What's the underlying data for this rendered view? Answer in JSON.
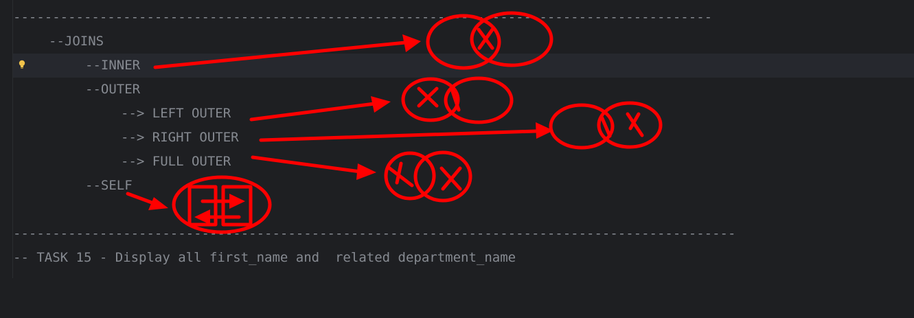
{
  "editor": {
    "lines": {
      "sep1": "-----------------------------------------------------------------------------------------",
      "joins": "--JOINS",
      "inner": "--INNER",
      "outer": "--OUTER",
      "left_outer": "--> LEFT OUTER",
      "right_outer": "--> RIGHT OUTER",
      "full_outer": "--> FULL OUTER",
      "self": "--SELF",
      "sep2": "--------------------------------------------------------------------------------------------",
      "task": "-- TASK 15 - Display all first_name and  related department_name"
    }
  },
  "colors": {
    "background": "#1e1f22",
    "current_line": "#26282e",
    "comment_text": "#868a91",
    "annotation": "#ff0000",
    "bulb": "#f0c24a"
  },
  "icons": {
    "intention_bulb": "lightbulb-icon"
  }
}
